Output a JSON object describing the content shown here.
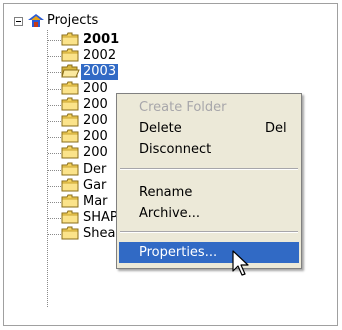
{
  "tree": {
    "root_label": "Projects",
    "items": [
      {
        "label": "2001",
        "bold": true
      },
      {
        "label": "2002"
      },
      {
        "label": "2003",
        "selected": true
      },
      {
        "label": "200"
      },
      {
        "label": "200"
      },
      {
        "label": "200"
      },
      {
        "label": "200"
      },
      {
        "label": "200"
      },
      {
        "label": "Der"
      },
      {
        "label": "Gar"
      },
      {
        "label": "Mar"
      },
      {
        "label": "SHAPE 6"
      },
      {
        "label": "Shear Walls"
      }
    ]
  },
  "context_menu": {
    "items": [
      {
        "label": "Create Folder",
        "enabled": false
      },
      {
        "label": "Delete",
        "shortcut": "Del"
      },
      {
        "label": "Disconnect"
      },
      {
        "label": "Rename"
      },
      {
        "label": "Archive..."
      },
      {
        "label": "Properties...",
        "highlighted": true
      }
    ]
  },
  "colors": {
    "selection": "#316ac5",
    "menu_bg": "#ece9d8",
    "folder": "#f4d25e",
    "disabled_text": "#a7a6aa"
  }
}
